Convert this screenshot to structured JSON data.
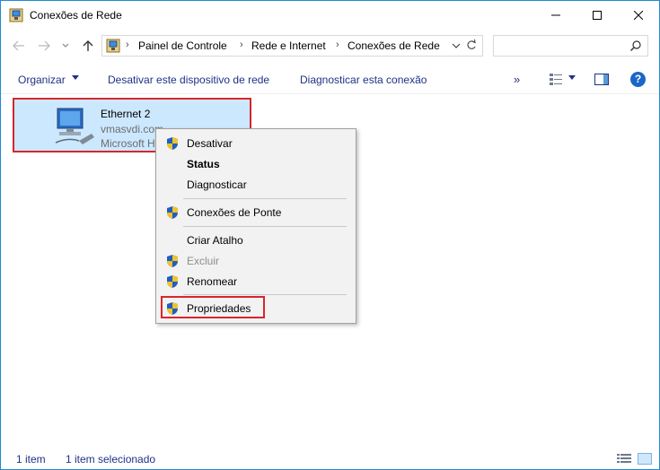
{
  "window": {
    "title": "Conexões de Rede",
    "controls": {
      "minimize": "–",
      "maximize": "☐",
      "close": "✕"
    }
  },
  "address": {
    "crumbs": [
      "Painel de Controle",
      "Rede e Internet",
      "Conexões de Rede"
    ],
    "separator": "›",
    "search_placeholder": ""
  },
  "commands": {
    "organize": "Organizar",
    "disable_device": "Desativar este dispositivo de rede",
    "diagnose": "Diagnosticar esta conexão",
    "more": "»",
    "help": "?"
  },
  "item": {
    "name": "Ethernet 2",
    "line2": "vmasvdi.com",
    "line3": "Microsoft Hyper-V Network Adapter",
    "selected": true
  },
  "context_menu": {
    "items": [
      {
        "label": "Desativar",
        "shield": true,
        "bold": false,
        "disabled": false
      },
      {
        "label": "Status",
        "shield": false,
        "bold": true,
        "disabled": false
      },
      {
        "label": "Diagnosticar",
        "shield": false,
        "bold": false,
        "disabled": false
      },
      {
        "label": "Conexões de Ponte",
        "shield": true,
        "bold": false,
        "disabled": false
      },
      {
        "label": "Criar Atalho",
        "shield": false,
        "bold": false,
        "disabled": false
      },
      {
        "label": "Excluir",
        "shield": true,
        "bold": false,
        "disabled": true
      },
      {
        "label": "Renomear",
        "shield": true,
        "bold": false,
        "disabled": false
      },
      {
        "label": "Propriedades",
        "shield": true,
        "bold": false,
        "disabled": false,
        "highlighted": true
      }
    ]
  },
  "status": {
    "count": "1 item",
    "selected": "1 item selecionado"
  },
  "colors": {
    "accent": "#1e3287",
    "selection": "#cce8ff",
    "highlight_border": "#d8262e"
  }
}
